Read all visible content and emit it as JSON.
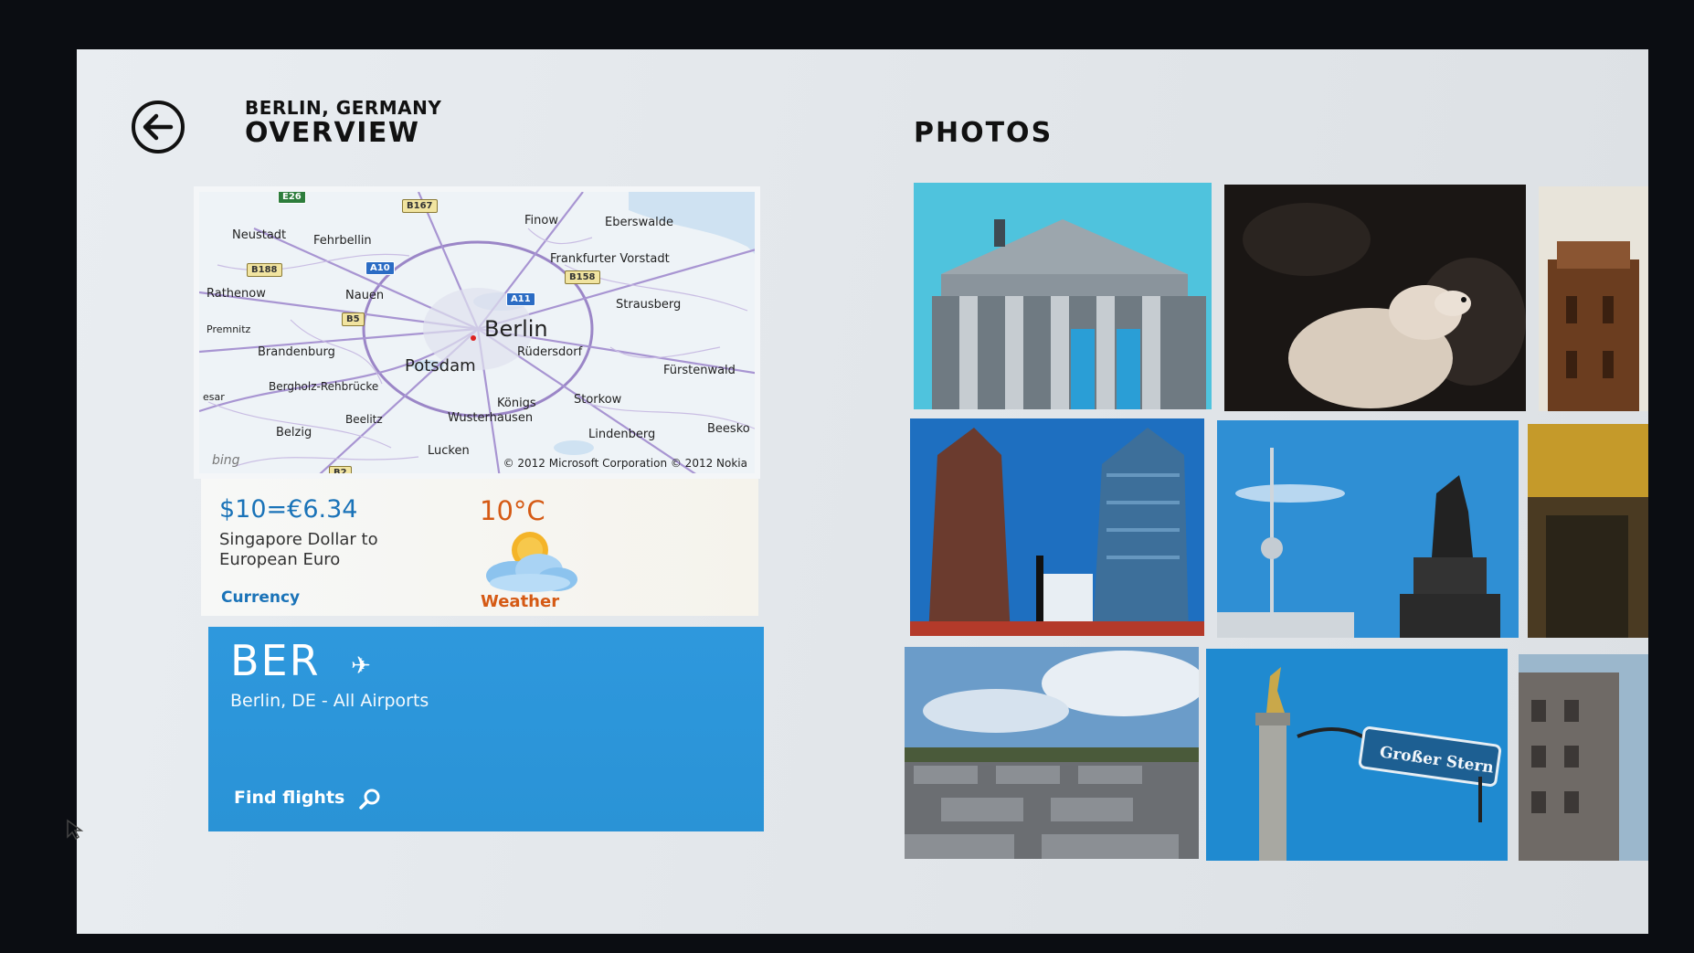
{
  "header": {
    "location": "BERLIN, GERMANY",
    "title": "OVERVIEW",
    "photos_title": "PHOTOS"
  },
  "map": {
    "places": {
      "berlin": "Berlin",
      "potsdam": "Potsdam",
      "neustadt": "Neustadt",
      "fehrbellin": "Fehrbellin",
      "finow": "Finow",
      "eberswalde": "Eberswalde",
      "frankfurter_vorstadt": "Frankfurter Vorstadt",
      "rathenow": "Rathenow",
      "nauen": "Nauen",
      "strausberg": "Strausberg",
      "premnitz": "Premnitz",
      "brandenburg": "Brandenburg",
      "rudersdorf": "Rüdersdorf",
      "furstenwald": "Fürstenwald",
      "bergholz": "Bergholz-Rehbrücke",
      "esar": "esar",
      "konigs": "Königs",
      "wusterhausen": "Wusterhausen",
      "storkow": "Storkow",
      "beelitz": "Beelitz",
      "belzig": "Belzig",
      "lindenberg": "Lindenberg",
      "beesko": "Beesko",
      "luckenwalde": "Lucken"
    },
    "shields": {
      "e26": "E26",
      "b167": "B167",
      "b188": "B188",
      "a10": "A10",
      "b158": "B158",
      "a11": "A11",
      "b5": "B5",
      "b2": "B2"
    },
    "bing": "bing",
    "copyright": "© 2012 Microsoft Corporation  © 2012 Nokia"
  },
  "currency": {
    "value": "$10=€6.34",
    "description": "Singapore Dollar to European Euro",
    "label": "Currency"
  },
  "weather": {
    "temperature": "10°C",
    "label": "Weather",
    "icon": "partly-cloudy-icon"
  },
  "flights": {
    "code": "BER",
    "airport": "Berlin, DE - All Airports",
    "find_label": "Find flights",
    "icon": "airplane-icon"
  },
  "photos": {
    "count_visible": 9,
    "items": [
      "Reichstag",
      "Polar bear",
      "Building",
      "Potsdamer Platz towers",
      "TV tower and statue",
      "Building",
      "Holocaust memorial",
      "Victory column and Großer Stern sign",
      "Building"
    ],
    "sign_text": "Großer Stern"
  },
  "colors": {
    "accent_blue": "#2a93d6",
    "weather_orange": "#d55a15",
    "currency_blue": "#1a73b8"
  }
}
